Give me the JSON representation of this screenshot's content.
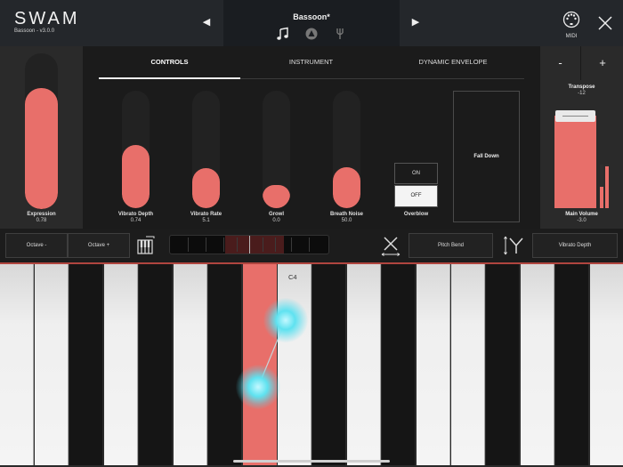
{
  "header": {
    "logo": "SWAM",
    "version": "Bassoon - v3.0.0",
    "preset_name": "Bassoon*",
    "prev_glyph": "◀",
    "next_glyph": "▶",
    "icons": [
      "music-note-icon",
      "instrument-icon",
      "fork-icon"
    ],
    "midi_label": "MIDI"
  },
  "tabs": [
    "CONTROLS",
    "INSTRUMENT",
    "DYNAMIC ENVELOPE"
  ],
  "active_tab": "CONTROLS",
  "expression": {
    "label": "Expression",
    "value": "0.78",
    "fill": 0.78
  },
  "controls": [
    {
      "label": "Vibrato Depth",
      "value": "0.74",
      "fill": 0.54
    },
    {
      "label": "Vibrato Rate",
      "value": "5.1",
      "fill": 0.34
    },
    {
      "label": "Growl",
      "value": "0.0",
      "fill": 0.2
    },
    {
      "label": "Breath Noise",
      "value": "50.0",
      "fill": 0.35
    }
  ],
  "overblow": {
    "label": "Overblow",
    "on_label": "ON",
    "off_label": "OFF",
    "state": "OFF"
  },
  "fall_down": "Fall Down",
  "transpose": {
    "label": "Transpose",
    "value": "-12",
    "minus": "-",
    "plus": "+"
  },
  "main_volume": {
    "label": "Main Volume",
    "value": "-3.0",
    "fill": 0.95,
    "meters": [
      0.5,
      0.95
    ]
  },
  "control_bar": {
    "octave_down": "Octave -",
    "octave_up": "Octave +",
    "x_assign": "Pitch Bend",
    "y_assign": "Vibrato Depth"
  },
  "keyboard": {
    "label": "C4",
    "highlighted_key": "C#4"
  },
  "colors": {
    "accent": "#e86f6a",
    "touch": "#5fe2f0",
    "background": "#161616"
  }
}
